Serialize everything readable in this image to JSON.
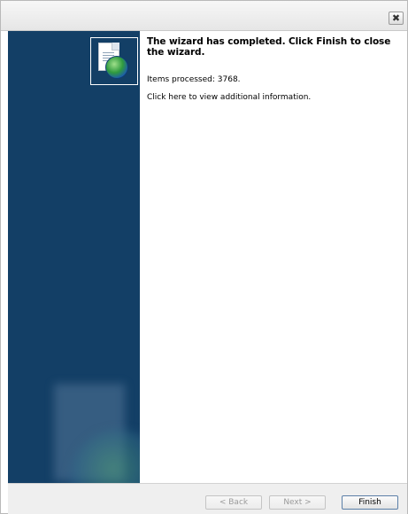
{
  "window": {
    "close_glyph": "✖"
  },
  "sidebar": {
    "icon": "document-globe-icon",
    "accent_color": "#133f66"
  },
  "main": {
    "heading": "The wizard has completed. Click Finish to close the wizard.",
    "items_processed": "Items processed: 3768.",
    "link": "Click here to view additional information."
  },
  "footer": {
    "back_label": "< Back",
    "next_label": "Next >",
    "finish_label": "Finish"
  }
}
